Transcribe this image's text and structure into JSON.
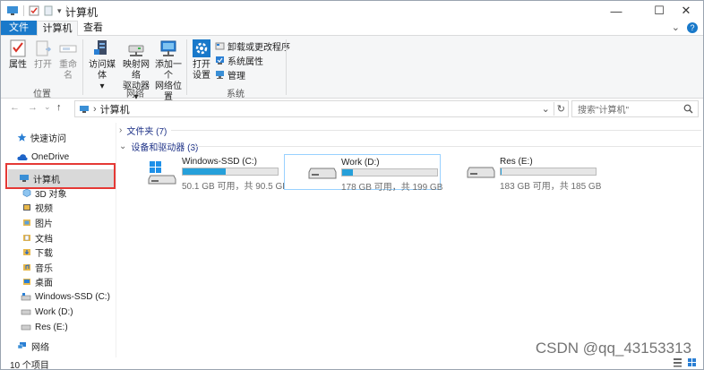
{
  "window": {
    "title": "计算机",
    "minimize_glyph": "—",
    "maximize_glyph": "☐",
    "close_glyph": "✕"
  },
  "ribbon_tabs": {
    "file": "文件",
    "computer": "计算机",
    "view": "查看"
  },
  "ribbon": {
    "location": {
      "label": "位置",
      "properties": "属性",
      "open": "打开",
      "rename": "重命名"
    },
    "network": {
      "label": "网络",
      "access_media_1": "访问媒体",
      "access_media_2": "▾",
      "map_drive_1": "映射网络",
      "map_drive_2": "驱动器 ▾",
      "add_location_1": "添加一个",
      "add_location_2": "网络位置"
    },
    "system": {
      "label": "系统",
      "open_settings_1": "打开",
      "open_settings_2": "设置",
      "uninstall": "卸载或更改程序",
      "system_properties": "系统属性",
      "manage": "管理"
    }
  },
  "address_bar": {
    "back": "←",
    "forward": "→",
    "recent": "⌄",
    "up": "↑",
    "path_root": "›",
    "path_item": "计算机",
    "dropdown": "⌄",
    "refresh": "↻",
    "search_placeholder": "搜索\"计算机\""
  },
  "sidebar": {
    "quick_access": "快速访问",
    "onedrive": "OneDrive",
    "this_pc": "计算机",
    "objects3d": "3D 对象",
    "videos": "视频",
    "pictures": "图片",
    "documents": "文档",
    "downloads": "下载",
    "music": "音乐",
    "desktop": "桌面",
    "drive_c": "Windows-SSD (C:)",
    "drive_d": "Work (D:)",
    "drive_e": "Res (E:)",
    "network": "网络"
  },
  "content": {
    "folders_header": "文件夹 (7)",
    "devices_header": "设备和驱动器 (3)",
    "drives": [
      {
        "name": "Windows-SSD (C:)",
        "info": "50.1 GB 可用，共 90.5 GB",
        "used_fraction": 0.45
      },
      {
        "name": "Work (D:)",
        "info": "178 GB 可用，共 199 GB",
        "used_fraction": 0.11
      },
      {
        "name": "Res (E:)",
        "info": "183 GB 可用，共 185 GB",
        "used_fraction": 0.01
      }
    ]
  },
  "statusbar": {
    "count": "10 个项目"
  },
  "watermark": "CSDN @qq_43153313",
  "colors": {
    "accent": "#1979ca",
    "bar_fill": "#26a0da",
    "highlight": "#cce8ff",
    "annotation_red": "#e53935"
  }
}
